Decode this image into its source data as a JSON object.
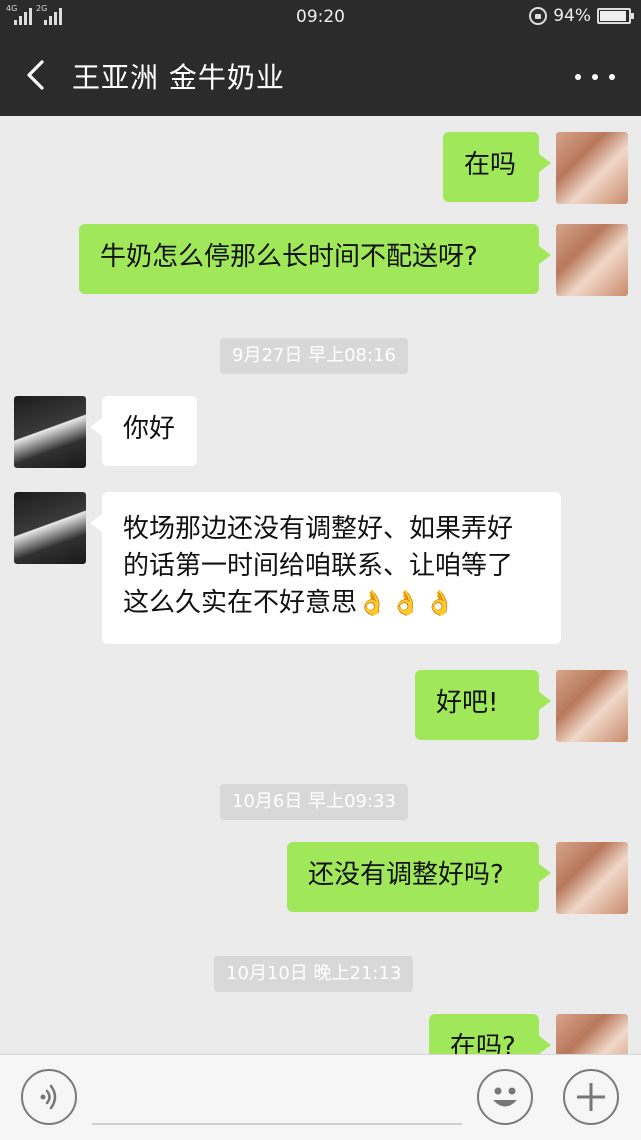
{
  "status_bar": {
    "network_1": "4G",
    "network_2": "2G",
    "time": "09:20",
    "battery_percent": "94%",
    "battery_level": 0.94
  },
  "header": {
    "title": "王亚洲 金牛奶业"
  },
  "messages": [
    {
      "sender": "me",
      "text": "在吗"
    },
    {
      "sender": "me",
      "text": "牛奶怎么停那么长时间不配送呀?"
    },
    {
      "timestamp": "9月27日 早上08:16"
    },
    {
      "sender": "them",
      "text": "你好"
    },
    {
      "sender": "them",
      "lines": [
        "牧场那边还没有调整好、如果弄好",
        "的话第一时间给咱联系、让咱等了",
        "这么久实在不好意思"
      ],
      "emoji": "👌👌👌"
    },
    {
      "sender": "me",
      "text": "好吧!"
    },
    {
      "timestamp": "10月6日 早上09:33"
    },
    {
      "sender": "me",
      "text": "还没有调整好吗?"
    },
    {
      "timestamp": "10月10日 晚上21:13"
    },
    {
      "sender": "me",
      "text": "在吗?"
    }
  ],
  "icons": {
    "back": "back-arrow-icon",
    "more": "more-dots-icon",
    "voice": "voice-icon",
    "emoji": "emoji-icon",
    "plus": "plus-icon"
  }
}
